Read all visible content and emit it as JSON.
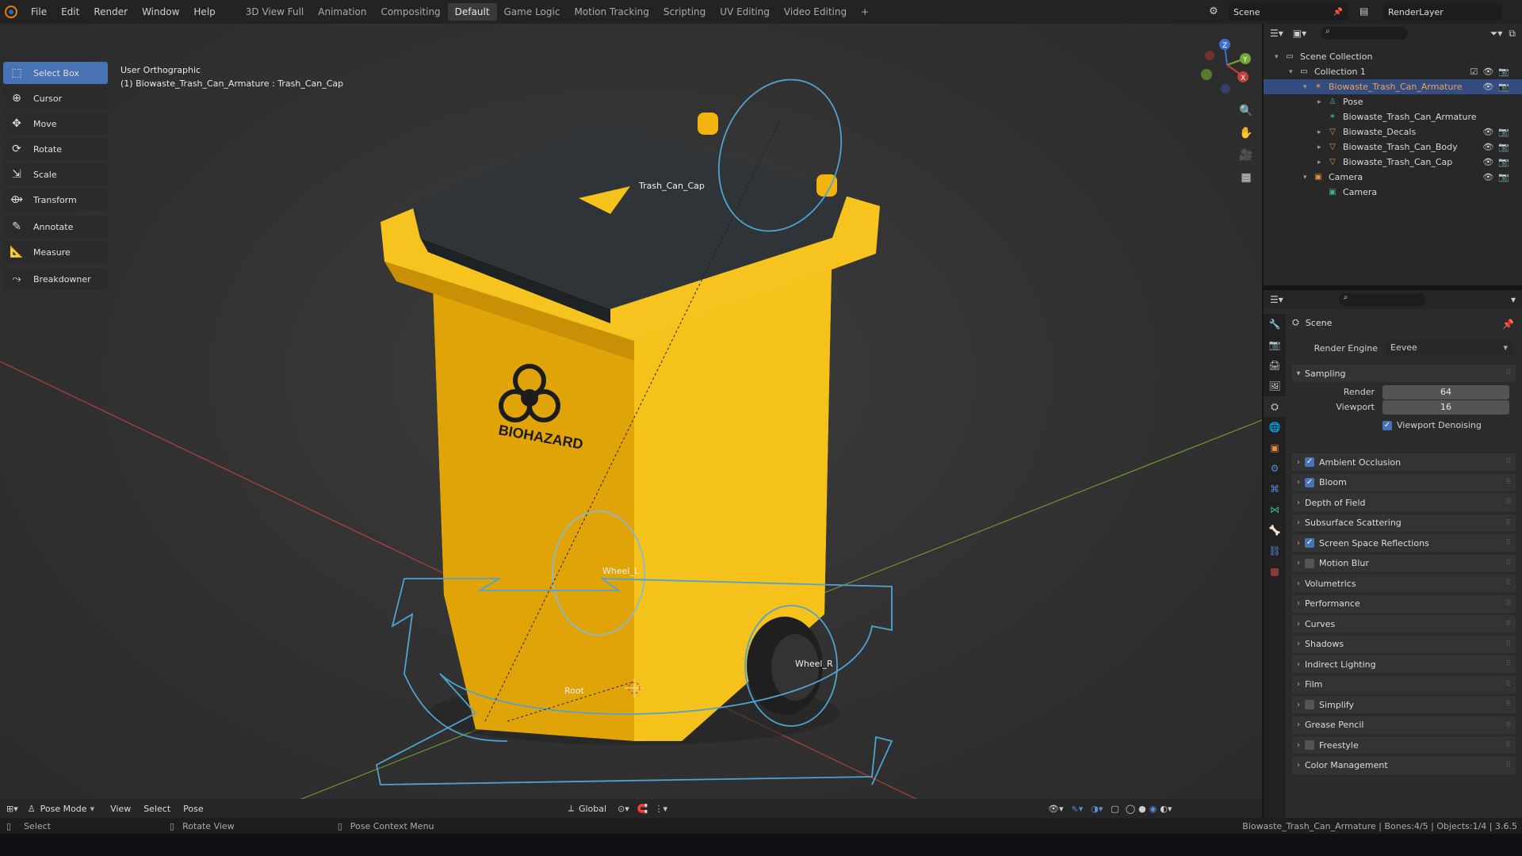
{
  "menubar": {
    "menus": [
      "File",
      "Edit",
      "Render",
      "Window",
      "Help"
    ],
    "workspaces": [
      "3D View Full",
      "Animation",
      "Compositing",
      "Default",
      "Game Logic",
      "Motion Tracking",
      "Scripting",
      "UV Editing",
      "Video Editing",
      "+"
    ],
    "active_workspace": "Default",
    "scene": "Scene",
    "render_layer": "RenderLayer"
  },
  "toolbar": {
    "tools": [
      {
        "label": "Select Box",
        "icon": "select-box-icon"
      },
      {
        "label": "Cursor",
        "icon": "cursor-icon"
      },
      {
        "label": "Move",
        "icon": "move-icon"
      },
      {
        "label": "Rotate",
        "icon": "rotate-icon"
      },
      {
        "label": "Scale",
        "icon": "scale-icon"
      },
      {
        "label": "Transform",
        "icon": "transform-icon"
      },
      {
        "label": "Annotate",
        "icon": "annotate-icon"
      },
      {
        "label": "Measure",
        "icon": "measure-icon"
      },
      {
        "label": "Breakdowner",
        "icon": "breakdowner-icon"
      }
    ],
    "active_tool": "Select Box"
  },
  "viewport": {
    "view_name": "User Orthographic",
    "active_info": "(1) Biowaste_Trash_Can_Armature : Trash_Can_Cap",
    "bone_labels": {
      "cap": "Trash_Can_Cap",
      "wheel_l": "Wheel_L",
      "wheel_r": "Wheel_R",
      "root": "Root"
    },
    "decal_text": "BIOHAZARD",
    "axis_labels": {
      "z": "Z",
      "y": "Y",
      "x": "X"
    },
    "colors": {
      "bin": "#f5b90f",
      "lid": "#2e3438",
      "bone_outline": "#4fa3d1"
    }
  },
  "vp_header": {
    "mode": "Pose Mode",
    "menus": [
      "View",
      "Select",
      "Pose"
    ],
    "orientation": "Global"
  },
  "statusbar": {
    "left": "Select",
    "middle": "Rotate View",
    "right_action": "Pose Context Menu",
    "stats": "Biowaste_Trash_Can_Armature | Bones:4/5 | Objects:1/4 | 3.6.5"
  },
  "outliner": {
    "rows": [
      {
        "label": "Scene Collection",
        "indent": 0,
        "icon": "scene-collection-icon"
      },
      {
        "label": "Collection 1",
        "indent": 1,
        "icon": "collection-icon"
      },
      {
        "label": "Biowaste_Trash_Can_Armature",
        "indent": 2,
        "icon": "armature-icon",
        "selected": true
      },
      {
        "label": "Pose",
        "indent": 3,
        "icon": "pose-icon"
      },
      {
        "label": "Biowaste_Trash_Can_Armature",
        "indent": 3,
        "icon": "armature-data-icon"
      },
      {
        "label": "Biowaste_Decals",
        "indent": 3,
        "icon": "mesh-icon"
      },
      {
        "label": "Biowaste_Trash_Can_Body",
        "indent": 3,
        "icon": "mesh-icon"
      },
      {
        "label": "Biowaste_Trash_Can_Cap",
        "indent": 3,
        "icon": "mesh-icon"
      },
      {
        "label": "Camera",
        "indent": 2,
        "icon": "camera-object-icon"
      },
      {
        "label": "Camera",
        "indent": 3,
        "icon": "camera-data-icon"
      }
    ]
  },
  "properties": {
    "context": "Scene",
    "render_engine_label": "Render Engine",
    "render_engine": "Eevee",
    "sampling": {
      "title": "Sampling",
      "render_label": "Render",
      "render": "64",
      "viewport_label": "Viewport",
      "viewport": "16",
      "denoise_label": "Viewport Denoising"
    },
    "panels": [
      {
        "label": "Ambient Occlusion",
        "checkbox": true
      },
      {
        "label": "Bloom",
        "checkbox": true
      },
      {
        "label": "Depth of Field"
      },
      {
        "label": "Subsurface Scattering"
      },
      {
        "label": "Screen Space Reflections",
        "checkbox": true
      },
      {
        "label": "Motion Blur",
        "checkbox": false
      },
      {
        "label": "Volumetrics"
      },
      {
        "label": "Performance"
      },
      {
        "label": "Curves"
      },
      {
        "label": "Shadows"
      },
      {
        "label": "Indirect Lighting"
      },
      {
        "label": "Film"
      },
      {
        "label": "Simplify",
        "checkbox": false
      },
      {
        "label": "Grease Pencil"
      },
      {
        "label": "Freestyle",
        "checkbox": false
      },
      {
        "label": "Color Management"
      }
    ]
  }
}
